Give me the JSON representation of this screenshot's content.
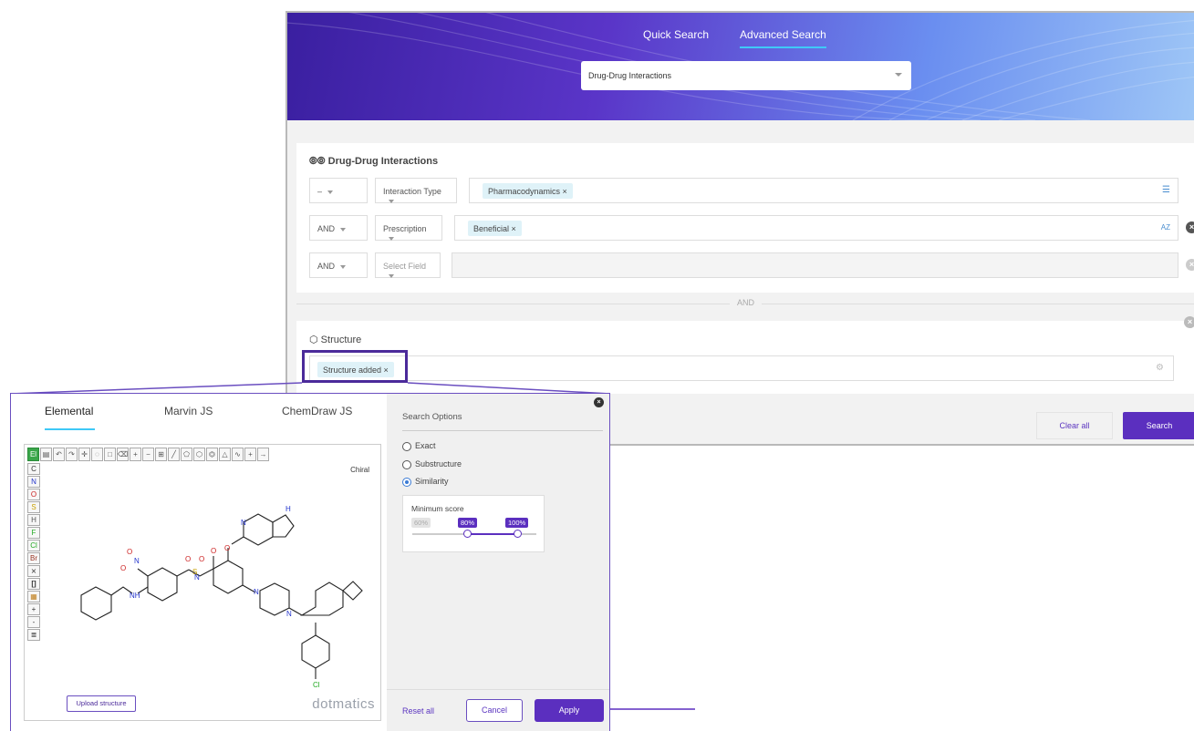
{
  "header": {
    "tabs": [
      {
        "label": "Quick Search",
        "active": false
      },
      {
        "label": "Advanced Search",
        "active": true
      }
    ],
    "database_select": "Drug-Drug Interactions"
  },
  "query": {
    "section_title": "Drug-Drug Interactions",
    "rows": [
      {
        "operator": "–",
        "field": "Interaction Type",
        "chip": "Pharmacodynamics ×"
      },
      {
        "operator": "AND",
        "field": "Prescription",
        "chip": "Beneficial ×"
      },
      {
        "operator": "AND",
        "field": "Select Field",
        "chip": ""
      }
    ],
    "separator": "AND",
    "structure_title": "Structure",
    "structure_chip": "Structure added ×"
  },
  "footer": {
    "clear_label": "Clear all",
    "search_label": "Search"
  },
  "editor": {
    "tabs": [
      "Elemental",
      "Marvin JS",
      "ChemDraw JS"
    ],
    "active_tab": "Elemental",
    "chiral_label": "Chiral",
    "upload_label": "Upload structure",
    "brand": "dotmatics",
    "sidebar_atoms": [
      "C",
      "N",
      "O",
      "S",
      "H",
      "F",
      "Cl",
      "Br"
    ],
    "toolbar_first": "El"
  },
  "search_options": {
    "title": "Search Options",
    "modes": [
      {
        "label": "Exact",
        "selected": false
      },
      {
        "label": "Substructure",
        "selected": false
      },
      {
        "label": "Similarity",
        "selected": true
      }
    ],
    "min_score_label": "Minimum score",
    "score_labels": [
      "60%",
      "80%",
      "100%"
    ],
    "score_range": [
      0.8,
      1.0
    ],
    "reset_label": "Reset all",
    "cancel_label": "Cancel",
    "apply_label": "Apply"
  },
  "colors": {
    "accent": "#5b2fbf",
    "highlight": "#3fc9f7",
    "chip_bg": "#dff2f8"
  }
}
